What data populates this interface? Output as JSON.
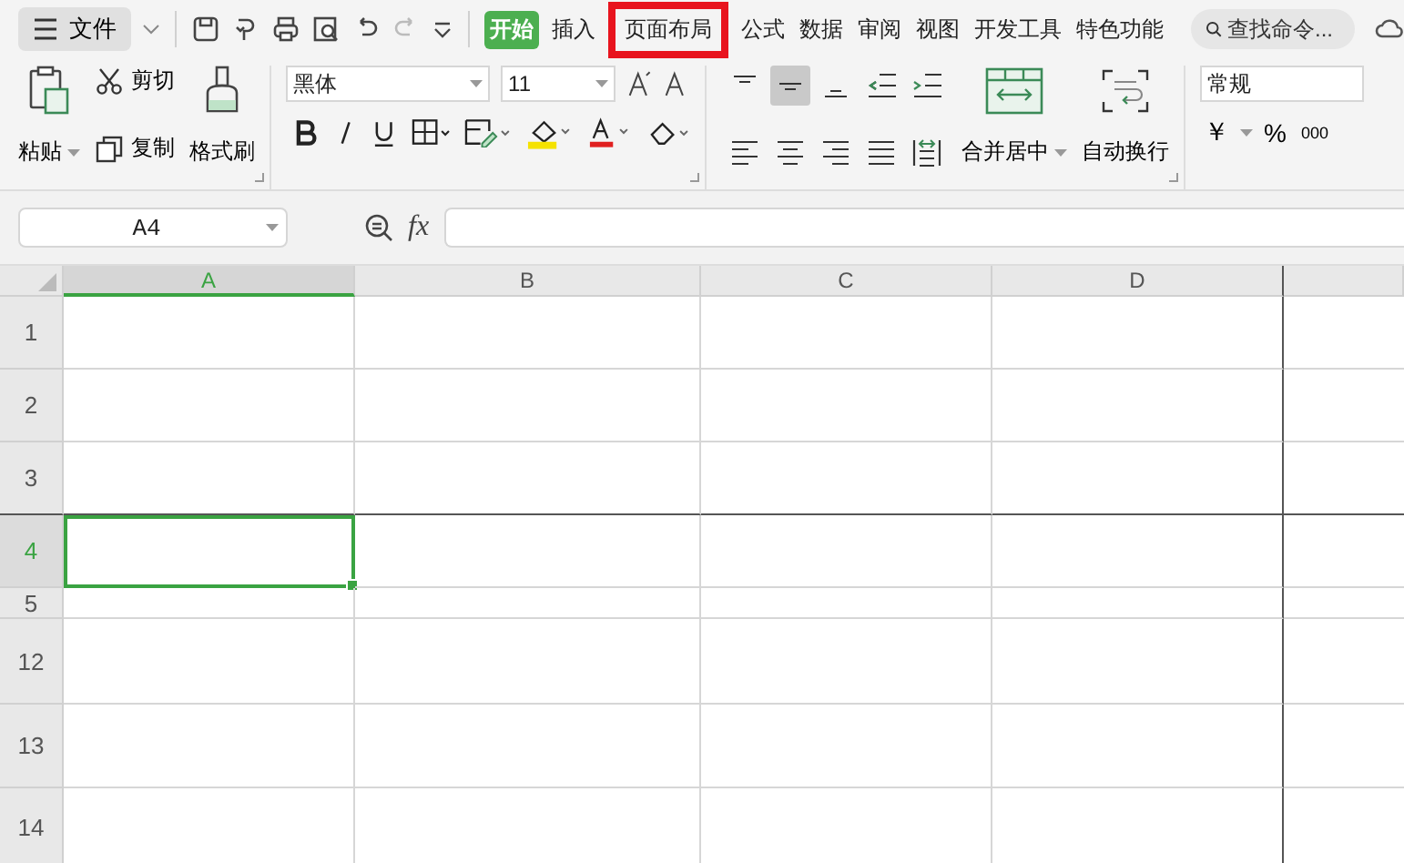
{
  "menu": {
    "file_label": "文件",
    "tabs": [
      {
        "label": "开始",
        "selected": true,
        "highlighted": false
      },
      {
        "label": "插入",
        "selected": false,
        "highlighted": false
      },
      {
        "label": "页面布局",
        "selected": false,
        "highlighted": true
      },
      {
        "label": "公式",
        "selected": false,
        "highlighted": false
      },
      {
        "label": "数据",
        "selected": false,
        "highlighted": false
      },
      {
        "label": "审阅",
        "selected": false,
        "highlighted": false
      },
      {
        "label": "视图",
        "selected": false,
        "highlighted": false
      },
      {
        "label": "开发工具",
        "selected": false,
        "highlighted": false
      },
      {
        "label": "特色功能",
        "selected": false,
        "highlighted": false
      }
    ],
    "search": {
      "placeholder": "查找命令..."
    }
  },
  "ribbon": {
    "clipboard": {
      "paste": "粘贴",
      "cut": "剪切",
      "copy": "复制",
      "format_painter": "格式刷"
    },
    "font": {
      "name": "黑体",
      "size": "11"
    },
    "alignment": {
      "merge": "合并居中",
      "wrap": "自动换行",
      "center_selected": true
    },
    "number": {
      "format": "常规",
      "currency": "￥",
      "percent": "%",
      "thousands": "000"
    }
  },
  "formula_bar": {
    "name_box": "A4",
    "fx": "fx"
  },
  "sheet": {
    "columns": [
      {
        "label": "A",
        "selected": true
      },
      {
        "label": "B",
        "selected": false
      },
      {
        "label": "C",
        "selected": false
      },
      {
        "label": "D",
        "selected": false
      }
    ],
    "rows": [
      {
        "label": "1",
        "selected": false
      },
      {
        "label": "2",
        "selected": false
      },
      {
        "label": "3",
        "selected": false
      },
      {
        "label": "4",
        "selected": true
      },
      {
        "label": "5",
        "selected": false
      },
      {
        "label": "12",
        "selected": false
      },
      {
        "label": "13",
        "selected": false
      },
      {
        "label": "14",
        "selected": false
      }
    ]
  }
}
